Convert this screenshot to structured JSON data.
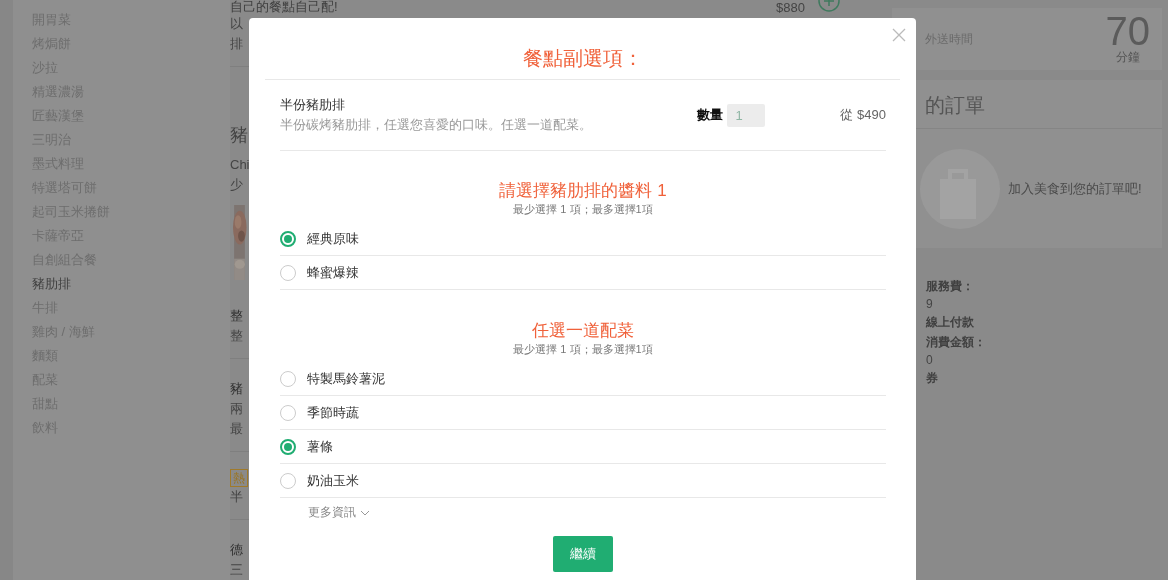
{
  "sidebar": {
    "items": [
      {
        "label": "開胃菜",
        "selected": false
      },
      {
        "label": "烤焗餅",
        "selected": false
      },
      {
        "label": "沙拉",
        "selected": false
      },
      {
        "label": "精選濃湯",
        "selected": false
      },
      {
        "label": "匠藝漢堡",
        "selected": false
      },
      {
        "label": "三明治",
        "selected": false
      },
      {
        "label": "墨式料理",
        "selected": false
      },
      {
        "label": "特選塔可餅",
        "selected": false
      },
      {
        "label": "起司玉米捲餅",
        "selected": false
      },
      {
        "label": "卡薩帝亞",
        "selected": false
      },
      {
        "label": "自創組合餐",
        "selected": false
      },
      {
        "label": "豬肋排",
        "selected": true
      },
      {
        "label": "牛排",
        "selected": false
      },
      {
        "label": "雞肉 / 海鮮",
        "selected": false
      },
      {
        "label": "麵類",
        "selected": false
      },
      {
        "label": "配菜",
        "selected": false
      },
      {
        "label": "甜點",
        "selected": false
      },
      {
        "label": "飲料",
        "selected": false
      }
    ]
  },
  "menu": {
    "price": "$880",
    "fragments": [
      {
        "kind": "title",
        "text": "自己的餐點自己配!"
      },
      {
        "kind": "line",
        "text": "以"
      },
      {
        "kind": "line",
        "text": "排"
      },
      {
        "kind": "rule"
      },
      {
        "kind": "heading",
        "text": "豬"
      },
      {
        "kind": "line",
        "text": "Chi"
      },
      {
        "kind": "line",
        "text": "少"
      },
      {
        "kind": "picture"
      },
      {
        "kind": "strong",
        "text": "整"
      },
      {
        "kind": "line",
        "text": "整"
      },
      {
        "kind": "rule"
      },
      {
        "kind": "strong",
        "text": "豬"
      },
      {
        "kind": "line",
        "text": "兩"
      },
      {
        "kind": "line",
        "text": "最"
      },
      {
        "kind": "rule"
      },
      {
        "kind": "tag",
        "text": "熱"
      },
      {
        "kind": "line",
        "text": "半"
      },
      {
        "kind": "rule"
      },
      {
        "kind": "strong",
        "text": "德"
      },
      {
        "kind": "line",
        "text": "三"
      }
    ]
  },
  "delivery": {
    "label": "外送時間",
    "minutes": "70",
    "unit": "分鐘"
  },
  "order": {
    "title": "的訂單",
    "empty_text": "加入美食到您的訂單吧!"
  },
  "info": [
    {
      "kind": "label",
      "text": "服務費："
    },
    {
      "kind": "value",
      "text": "9"
    },
    {
      "kind": "label",
      "text": "線上付款"
    },
    {
      "kind": "label",
      "text": "消費金額："
    },
    {
      "kind": "value",
      "text": "0"
    },
    {
      "kind": "label",
      "text": "券"
    }
  ],
  "modal": {
    "title": "餐點副選項：",
    "item": {
      "name": "半份豬肋排",
      "description": "半份碳烤豬肋排，任選您喜愛的口味。任選一道配菜。",
      "quantity_label": "數量",
      "quantity": "1",
      "price": "從 $490"
    },
    "groups": [
      {
        "title": "請選擇豬肋排的醬料 1",
        "rule": "最少選擇 1 項；最多選擇1項",
        "options": [
          {
            "label": "經典原味",
            "selected": true
          },
          {
            "label": "蜂蜜爆辣",
            "selected": false
          }
        ]
      },
      {
        "title": "任選一道配菜",
        "rule": "最少選擇 1 項；最多選擇1項",
        "options": [
          {
            "label": "特製馬鈴薯泥",
            "selected": false
          },
          {
            "label": "季節時蔬",
            "selected": false
          },
          {
            "label": "薯條",
            "selected": true
          },
          {
            "label": "奶油玉米",
            "selected": false
          }
        ]
      }
    ],
    "more": "更多資訊",
    "button": "繼續"
  }
}
